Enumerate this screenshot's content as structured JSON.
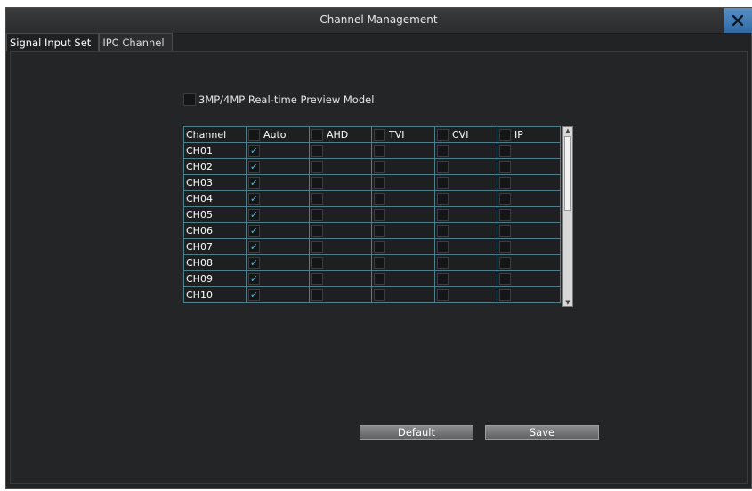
{
  "window": {
    "title": "Channel Management",
    "close_icon": "close-icon"
  },
  "tabs": [
    {
      "label": "Signal Input Set",
      "active": true
    },
    {
      "label": "IPC Channel",
      "active": false
    }
  ],
  "preview_model": {
    "label": "3MP/4MP Real-time Preview Model",
    "checked": false
  },
  "grid": {
    "columns": [
      "Channel",
      "Auto",
      "AHD",
      "TVI",
      "CVI",
      "IP"
    ],
    "rows": [
      {
        "channel": "CH01",
        "auto": true,
        "ahd": false,
        "tvi": false,
        "cvi": false,
        "ip": false
      },
      {
        "channel": "CH02",
        "auto": true,
        "ahd": false,
        "tvi": false,
        "cvi": false,
        "ip": false
      },
      {
        "channel": "CH03",
        "auto": true,
        "ahd": false,
        "tvi": false,
        "cvi": false,
        "ip": false
      },
      {
        "channel": "CH04",
        "auto": true,
        "ahd": false,
        "tvi": false,
        "cvi": false,
        "ip": false
      },
      {
        "channel": "CH05",
        "auto": true,
        "ahd": false,
        "tvi": false,
        "cvi": false,
        "ip": false
      },
      {
        "channel": "CH06",
        "auto": true,
        "ahd": false,
        "tvi": false,
        "cvi": false,
        "ip": false
      },
      {
        "channel": "CH07",
        "auto": true,
        "ahd": false,
        "tvi": false,
        "cvi": false,
        "ip": false
      },
      {
        "channel": "CH08",
        "auto": true,
        "ahd": false,
        "tvi": false,
        "cvi": false,
        "ip": false
      },
      {
        "channel": "CH09",
        "auto": true,
        "ahd": false,
        "tvi": false,
        "cvi": false,
        "ip": false
      },
      {
        "channel": "CH10",
        "auto": true,
        "ahd": false,
        "tvi": false,
        "cvi": false,
        "ip": false
      }
    ],
    "check_glyph": "✓"
  },
  "buttons": {
    "default_label": "Default",
    "save_label": "Save"
  },
  "colors": {
    "accent_check": "#49b8e6",
    "grid_line": "#4f7f8d",
    "close_button": "#3f7bb8"
  }
}
